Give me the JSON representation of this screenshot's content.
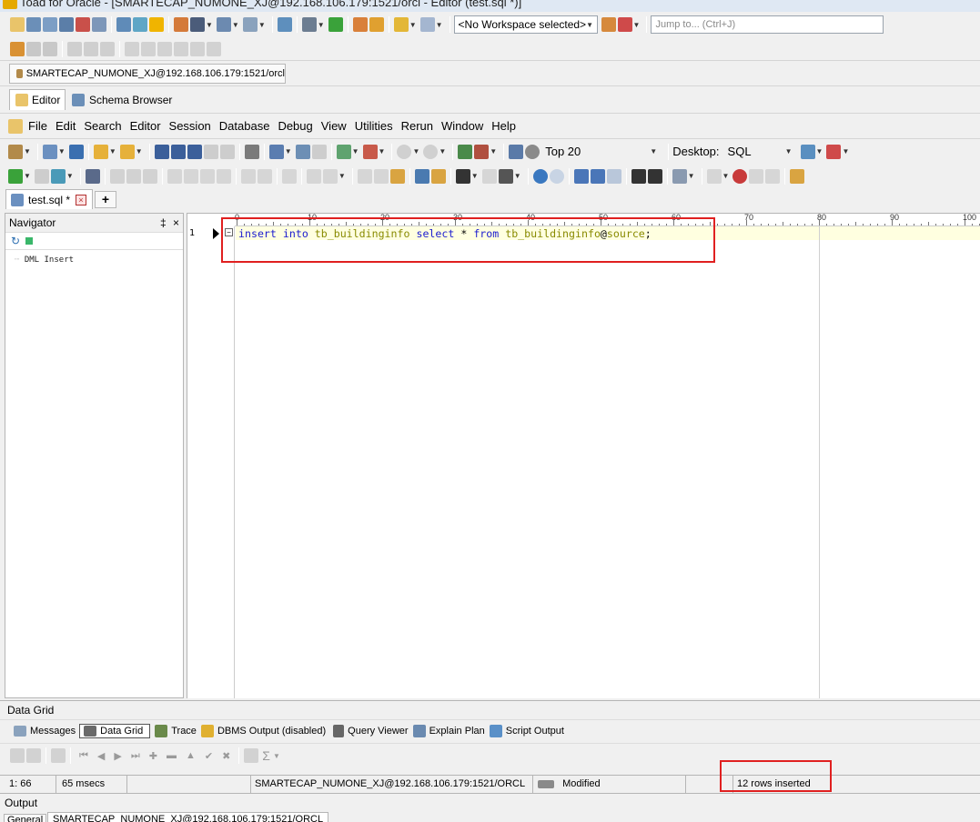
{
  "window": {
    "title": "Toad for Oracle - [SMARTECAP_NUMONE_XJ@192.168.106.179:1521/orcl - Editor (test.sql *)]"
  },
  "workspace": {
    "selected": "<No Workspace selected>",
    "jump_placeholder": "Jump to... (Ctrl+J)"
  },
  "connection_tab": "SMARTECAP_NUMONE_XJ@192.168.106.179:1521/orcl",
  "main_tabs": [
    "Editor",
    "Schema Browser"
  ],
  "menu": [
    "File",
    "Edit",
    "Search",
    "Editor",
    "Session",
    "Database",
    "Debug",
    "View",
    "Utilities",
    "Rerun",
    "Window",
    "Help"
  ],
  "toolbar": {
    "top_value": "Top 20",
    "desktop_label": "Desktop:",
    "desktop_value": "SQL"
  },
  "file_tab": {
    "name": "test.sql *",
    "new_tab": "+"
  },
  "navigator": {
    "title": "Navigator",
    "pin": "‡",
    "close": "×",
    "items": [
      "DML Insert"
    ]
  },
  "ruler": [
    "0",
    "10",
    "20",
    "30",
    "40",
    "50",
    "60",
    "70",
    "80",
    "90",
    "100"
  ],
  "editor": {
    "line_number": "1",
    "code_tokens": [
      {
        "t": "insert",
        "c": "kw"
      },
      {
        "t": " ",
        "c": ""
      },
      {
        "t": "into",
        "c": "kw"
      },
      {
        "t": " ",
        "c": ""
      },
      {
        "t": "tb_buildinginfo",
        "c": "id"
      },
      {
        "t": " ",
        "c": ""
      },
      {
        "t": "select",
        "c": "kw"
      },
      {
        "t": " * ",
        "c": ""
      },
      {
        "t": "from",
        "c": "kw"
      },
      {
        "t": " ",
        "c": ""
      },
      {
        "t": "tb_buildinginfo",
        "c": "id"
      },
      {
        "t": "@",
        "c": ""
      },
      {
        "t": "source",
        "c": "id"
      },
      {
        "t": ";",
        "c": ""
      }
    ]
  },
  "results": {
    "title": "Data Grid",
    "tabs": [
      "Messages",
      "Data Grid",
      "Trace",
      "DBMS Output (disabled)",
      "Query Viewer",
      "Explain Plan",
      "Script Output"
    ],
    "active_tab": "Data Grid"
  },
  "status": {
    "position": "1: 66",
    "time": "65 msecs",
    "connection": "SMARTECAP_NUMONE_XJ@192.168.106.179:1521/ORCL",
    "state": "Modified",
    "message": "12 rows inserted"
  },
  "output": {
    "title": "Output",
    "tabs": [
      "General",
      "SMARTECAP_NUMONE_XJ@192.168.106.179:1521/ORCL"
    ]
  },
  "colors": {
    "highlight": "#e02020",
    "keyword": "#1c1ccf",
    "identifier": "#888a00",
    "current_line": "#ffffe0"
  }
}
